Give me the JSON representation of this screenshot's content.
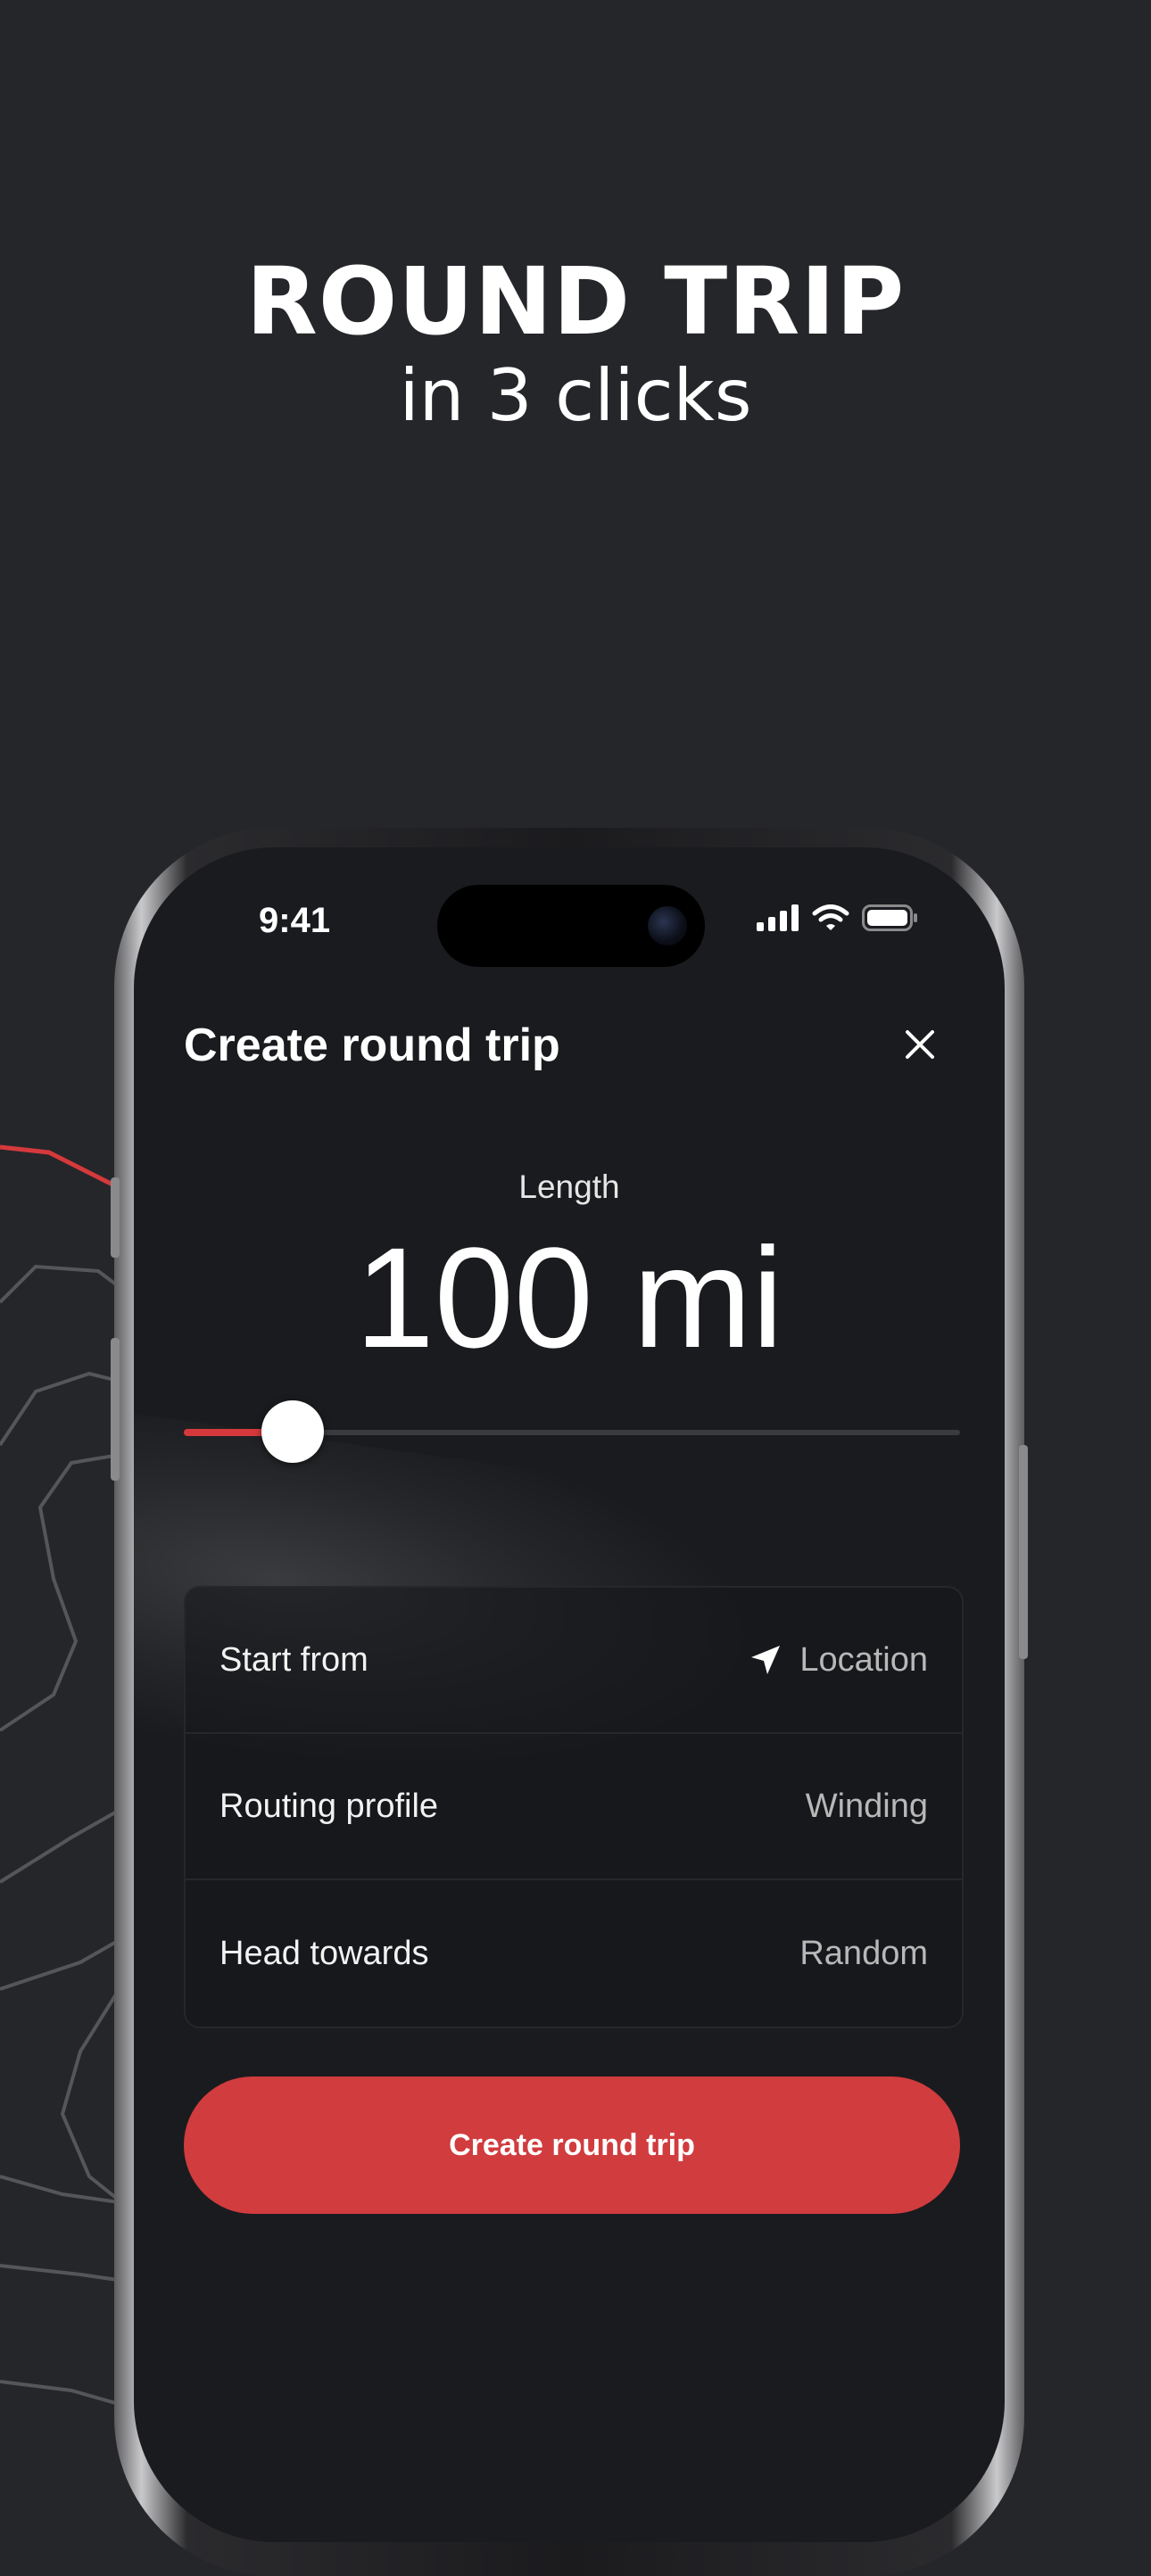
{
  "headline": {
    "title": "ROUND TRIP",
    "subtitle": "in 3 clicks"
  },
  "status_bar": {
    "time": "9:41",
    "icons": [
      "cellular-signal-icon",
      "wifi-icon",
      "battery-icon"
    ]
  },
  "panel": {
    "title": "Create round trip",
    "close_icon": "close-icon"
  },
  "length": {
    "label": "Length",
    "value": "100 mi",
    "slider_fraction": 0.14
  },
  "options": [
    {
      "label": "Start from",
      "value": "Location",
      "icon": "location-arrow-icon"
    },
    {
      "label": "Routing profile",
      "value": "Winding"
    },
    {
      "label": "Head towards",
      "value": "Random"
    }
  ],
  "primary_action": {
    "label": "Create round trip"
  },
  "colors": {
    "background": "#25262a",
    "screen": "#1a1b1e",
    "accent": "#d13c3e",
    "text_primary": "#ffffff",
    "text_secondary": "#b8b8b8"
  }
}
